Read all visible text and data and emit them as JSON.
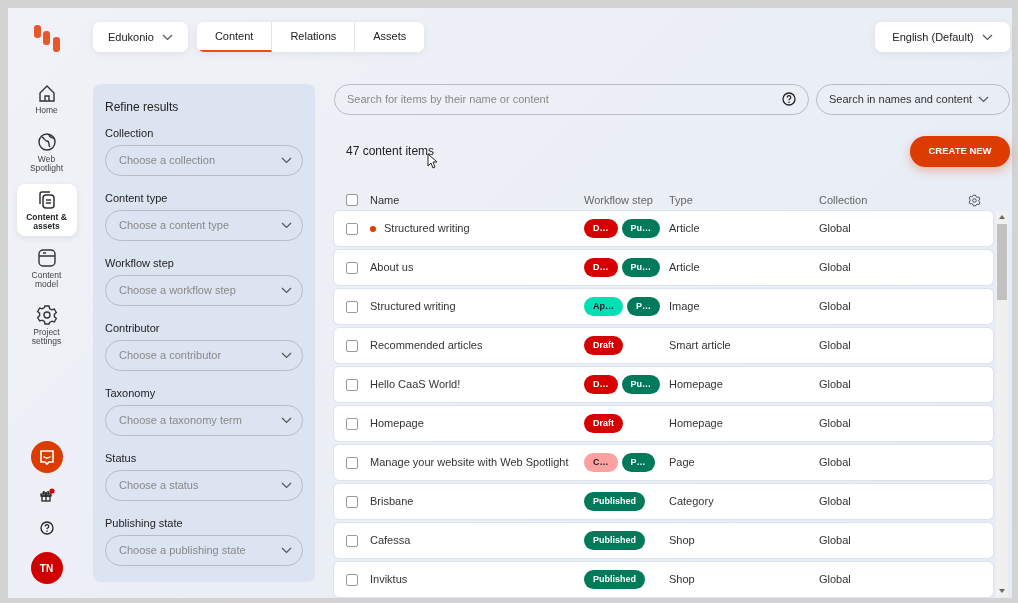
{
  "rail": {
    "items": [
      {
        "kind": "home",
        "label": "Home",
        "selected": false
      },
      {
        "kind": "globe",
        "label": "Web Spotlight",
        "selected": false
      },
      {
        "kind": "content",
        "label": "Content & assets",
        "selected": true
      },
      {
        "kind": "model",
        "label": "Content model",
        "selected": false
      },
      {
        "kind": "settings",
        "label": "Project settings",
        "selected": false
      }
    ],
    "bottom": [
      {
        "kind": "feedback"
      },
      {
        "kind": "gift",
        "notification": true
      },
      {
        "kind": "help"
      },
      {
        "kind": "avatar",
        "label": "TN"
      }
    ]
  },
  "project_selector": {
    "label": "Edukonio"
  },
  "tabs": [
    {
      "label": "Content",
      "selected": true
    },
    {
      "label": "Relations",
      "selected": false
    },
    {
      "label": "Assets",
      "selected": false
    }
  ],
  "language_selector": {
    "label": "English (Default)"
  },
  "filters": {
    "title": "Refine results",
    "fields": [
      {
        "label": "Collection",
        "placeholder": "Choose a collection"
      },
      {
        "label": "Content type",
        "placeholder": "Choose a content type"
      },
      {
        "label": "Workflow step",
        "placeholder": "Choose a workflow step"
      },
      {
        "label": "Contributor",
        "placeholder": "Choose a contributor"
      },
      {
        "label": "Taxonomy",
        "placeholder": "Choose a taxonomy term"
      },
      {
        "label": "Status",
        "placeholder": "Choose a status"
      },
      {
        "label": "Publishing state",
        "placeholder": "Choose a publishing state"
      }
    ]
  },
  "search": {
    "placeholder": "Search for items by their name or content",
    "scope": "Search in names and content"
  },
  "count": "47 content items",
  "create_button": "CREATE NEW",
  "table": {
    "select_all_checked": false,
    "columns": [
      "Name",
      "Workflow step",
      "Type",
      "Collection"
    ],
    "rows": [
      {
        "checked": false,
        "changed": true,
        "name": "Structured writing",
        "workflow": [
          {
            "label": "D…",
            "color": "#d60000"
          },
          {
            "label": "Pu…",
            "color": "#007a5a"
          }
        ],
        "type": "Article",
        "collection": "Global"
      },
      {
        "checked": false,
        "changed": false,
        "name": "About us",
        "workflow": [
          {
            "label": "D…",
            "color": "#d60000"
          },
          {
            "label": "Pu…",
            "color": "#007a5a"
          }
        ],
        "type": "Article",
        "collection": "Global"
      },
      {
        "checked": false,
        "changed": false,
        "name": "Structured writing",
        "workflow": [
          {
            "label": "Ap…",
            "color": "#00e0b4"
          },
          {
            "label": "P…",
            "color": "#007a5a"
          }
        ],
        "type": "Image",
        "collection": "Global"
      },
      {
        "checked": false,
        "changed": false,
        "name": "Recommended articles",
        "workflow": [
          {
            "label": "Draft",
            "color": "#d60000"
          }
        ],
        "type": "Smart article",
        "collection": "Global"
      },
      {
        "checked": false,
        "changed": false,
        "name": "Hello CaaS World!",
        "workflow": [
          {
            "label": "D…",
            "color": "#d60000"
          },
          {
            "label": "Pu…",
            "color": "#007a5a"
          }
        ],
        "type": "Homepage",
        "collection": "Global"
      },
      {
        "checked": false,
        "changed": false,
        "name": "Homepage",
        "workflow": [
          {
            "label": "Draft",
            "color": "#d60000"
          }
        ],
        "type": "Homepage",
        "collection": "Global"
      },
      {
        "checked": false,
        "changed": false,
        "name": "Manage your website with Web Spotlight",
        "workflow": [
          {
            "label": "C…",
            "color": "#ffa0a0"
          },
          {
            "label": "P…",
            "color": "#007a5a"
          }
        ],
        "type": "Page",
        "collection": "Global"
      },
      {
        "checked": false,
        "changed": false,
        "name": "Brisbane",
        "workflow": [
          {
            "label": "Published",
            "color": "#007a5a"
          }
        ],
        "type": "Category",
        "collection": "Global"
      },
      {
        "checked": false,
        "changed": false,
        "name": "Cafessa",
        "workflow": [
          {
            "label": "Published",
            "color": "#007a5a"
          }
        ],
        "type": "Shop",
        "collection": "Global"
      },
      {
        "checked": false,
        "changed": false,
        "name": "Inviktus",
        "workflow": [
          {
            "label": "Published",
            "color": "#007a5a"
          }
        ],
        "type": "Shop",
        "collection": "Global"
      }
    ]
  }
}
